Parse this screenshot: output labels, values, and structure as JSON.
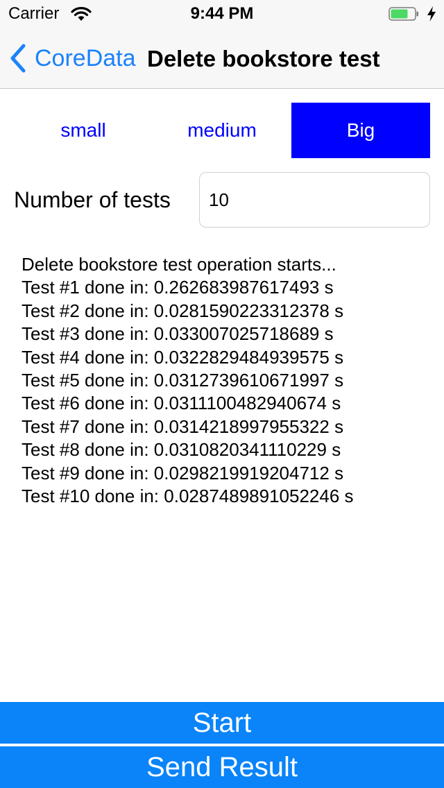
{
  "status_bar": {
    "carrier": "Carrier",
    "time": "9:44 PM",
    "battery_color": "#4cd964"
  },
  "nav": {
    "back_label": "CoreData",
    "title": "Delete bookstore test",
    "accent": "#1a82fb"
  },
  "segments": [
    {
      "label": "small",
      "selected": false
    },
    {
      "label": "medium",
      "selected": false
    },
    {
      "label": "Big",
      "selected": true
    }
  ],
  "tests": {
    "label": "Number of tests",
    "value": "10"
  },
  "log": [
    "Delete bookstore test operation starts...",
    "Test #1 done in: 0.262683987617493 s",
    "Test #2 done in: 0.0281590223312378 s",
    "Test #3 done in: 0.033007025718689 s",
    "Test #4 done in: 0.0322829484939575 s",
    "Test #5 done in: 0.0312739610671997 s",
    "Test #6 done in: 0.0311100482940674 s",
    "Test #7 done in: 0.0314218997955322 s",
    "Test #8 done in: 0.0310820341110229 s",
    "Test #9 done in: 0.0298219919204712 s",
    "Test #10 done in: 0.0287489891052246 s"
  ],
  "actions": {
    "start_label": "Start",
    "send_label": "Send Result",
    "button_color": "#0a84f8"
  }
}
